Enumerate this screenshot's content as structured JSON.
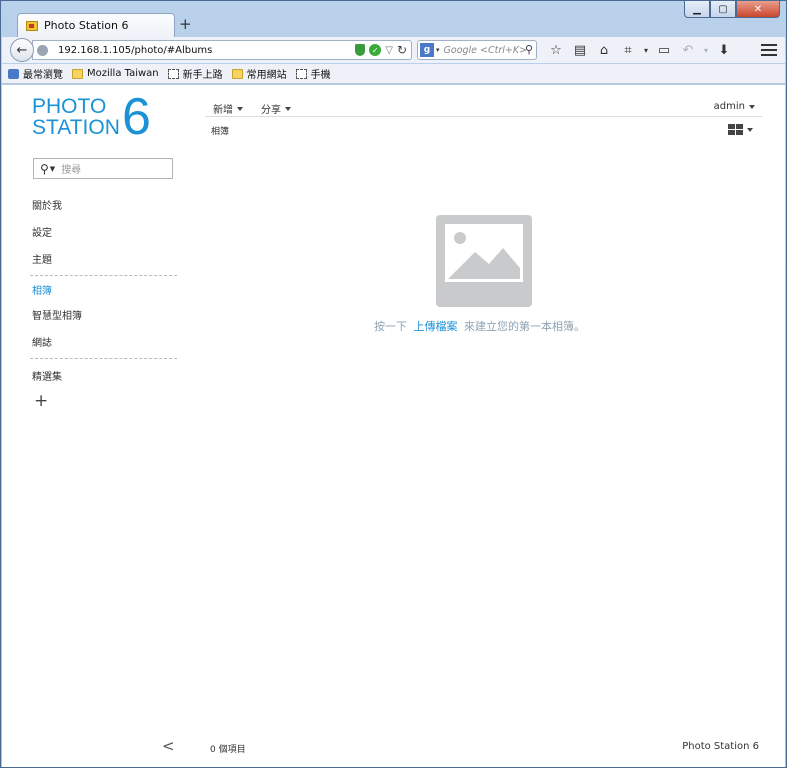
{
  "browser": {
    "tab_title": "Photo Station 6",
    "new_tab": "+",
    "url": "192.168.1.105/photo/#Albums",
    "search_placeholder": "Google <Ctrl+K>",
    "search_engine_letter": "g"
  },
  "bookmarks": [
    {
      "label": "最常瀏覽",
      "icon": "rss"
    },
    {
      "label": "Mozilla Taiwan",
      "icon": "folder"
    },
    {
      "label": "新手上路",
      "icon": "page"
    },
    {
      "label": "常用網站",
      "icon": "folder"
    },
    {
      "label": "手機",
      "icon": "page"
    }
  ],
  "logo": {
    "line1": "PHOTO",
    "line2": "STATION",
    "version": "6"
  },
  "sidebar": {
    "search_placeholder": "搜尋",
    "items": [
      {
        "label": "關於我"
      },
      {
        "label": "設定"
      },
      {
        "label": "主題"
      },
      {
        "label": "相簿"
      },
      {
        "label": "智慧型相簿"
      },
      {
        "label": "網誌"
      },
      {
        "label": "精選集"
      }
    ],
    "add_label": "+"
  },
  "header": {
    "new_label": "新增",
    "share_label": "分享",
    "user_label": "admin",
    "breadcrumb": "相簿"
  },
  "empty_state": {
    "prefix": "按一下",
    "link": "上傳檔案",
    "suffix": "來建立您的第一本相簿。"
  },
  "footer": {
    "collapse": "<",
    "item_count": "0 個項目",
    "product": "Photo Station 6"
  },
  "colors": {
    "accent": "#1b91d6",
    "placeholder_gray": "#c9cacb"
  }
}
